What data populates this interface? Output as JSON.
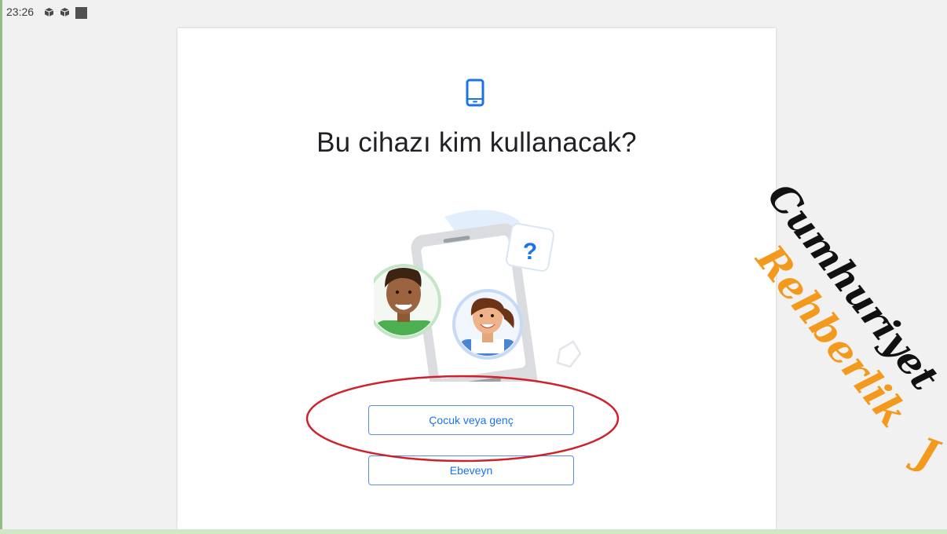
{
  "statusbar": {
    "time": "23:26",
    "icons": [
      "app-notification-icon",
      "app-notification-icon",
      "stop-square-icon"
    ]
  },
  "dialog": {
    "device_icon": "smartphone-icon",
    "title": "Bu cihazı kim kullanacak?",
    "illustration": "phone-with-parent-and-child-avatars",
    "buttons": {
      "child": "Çocuk veya genç",
      "parent": "Ebeveyn"
    }
  },
  "overlay": {
    "highlight": "red-ellipse-around-child-button",
    "watermark_line1": "Cumhuriyet",
    "watermark_line2": "Rehberlik",
    "watermark_fragment": "J"
  },
  "colors": {
    "accent": "#1a73e8",
    "button_border": "#5b8ed6",
    "highlight_red": "#d0212a",
    "watermark_orange": "#f39a1e"
  }
}
